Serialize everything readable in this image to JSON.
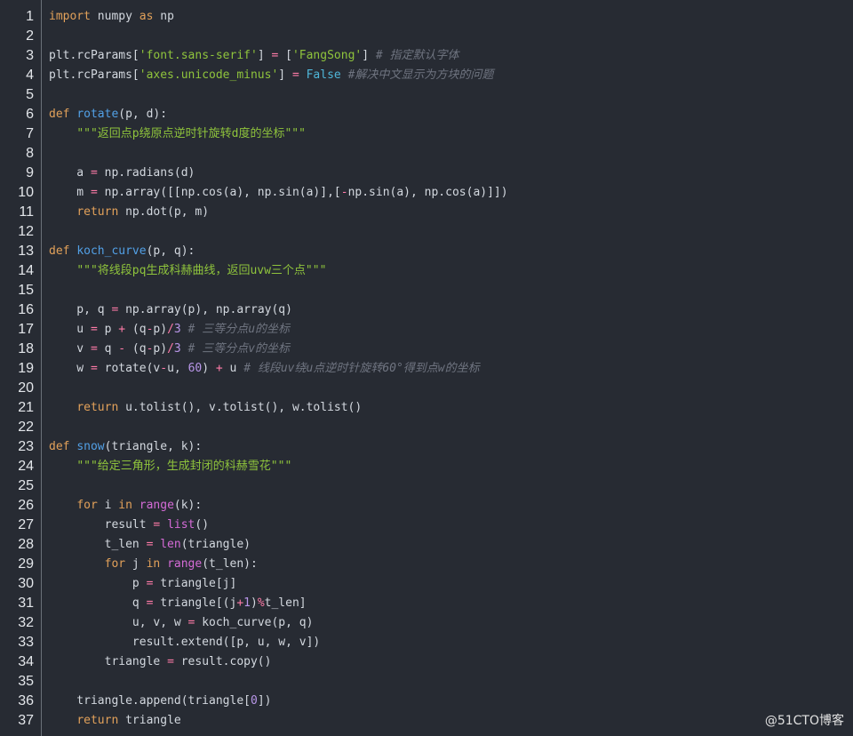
{
  "theme": {
    "background": "#272b33",
    "text": "#d3d8df",
    "keyword": "#e2a15a",
    "function": "#52a0e6",
    "string": "#8fc43c",
    "number": "#b896e8",
    "operator": "#ff7ba8",
    "constant": "#4fb6d8",
    "builtin": "#d46bd6",
    "comment": "#6f7480"
  },
  "watermark": "@51CTO博客",
  "lines": [
    {
      "n": "1",
      "tokens": [
        {
          "t": "import",
          "c": "kw"
        },
        {
          "t": " numpy ",
          "c": ""
        },
        {
          "t": "as",
          "c": "kw"
        },
        {
          "t": " np",
          "c": ""
        }
      ]
    },
    {
      "n": "2",
      "tokens": []
    },
    {
      "n": "3",
      "tokens": [
        {
          "t": "plt.rcParams[",
          "c": ""
        },
        {
          "t": "'font.sans-serif'",
          "c": "str"
        },
        {
          "t": "] ",
          "c": ""
        },
        {
          "t": "=",
          "c": "op"
        },
        {
          "t": " [",
          "c": ""
        },
        {
          "t": "'FangSong'",
          "c": "str"
        },
        {
          "t": "] ",
          "c": ""
        },
        {
          "t": "# 指定默认字体",
          "c": "cm"
        }
      ]
    },
    {
      "n": "4",
      "tokens": [
        {
          "t": "plt.rcParams[",
          "c": ""
        },
        {
          "t": "'axes.unicode_minus'",
          "c": "str"
        },
        {
          "t": "] ",
          "c": ""
        },
        {
          "t": "=",
          "c": "op"
        },
        {
          "t": " ",
          "c": ""
        },
        {
          "t": "False",
          "c": "const"
        },
        {
          "t": " #解决中文显示为方块的问题",
          "c": "cm"
        }
      ]
    },
    {
      "n": "5",
      "tokens": []
    },
    {
      "n": "6",
      "tokens": [
        {
          "t": "def",
          "c": "kw"
        },
        {
          "t": " ",
          "c": ""
        },
        {
          "t": "rotate",
          "c": "fn"
        },
        {
          "t": "(p, d):",
          "c": ""
        }
      ]
    },
    {
      "n": "7",
      "tokens": [
        {
          "t": "    ",
          "c": ""
        },
        {
          "t": "\"\"\"返回点p绕原点逆时针旋转d度的坐标\"\"\"",
          "c": "doc"
        }
      ]
    },
    {
      "n": "8",
      "tokens": []
    },
    {
      "n": "9",
      "tokens": [
        {
          "t": "    a ",
          "c": ""
        },
        {
          "t": "=",
          "c": "op"
        },
        {
          "t": " np.radians(d)",
          "c": ""
        }
      ]
    },
    {
      "n": "10",
      "tokens": [
        {
          "t": "    m ",
          "c": ""
        },
        {
          "t": "=",
          "c": "op"
        },
        {
          "t": " np.array([[np.cos(a), np.sin(a)],[",
          "c": ""
        },
        {
          "t": "-",
          "c": "op"
        },
        {
          "t": "np.sin(a), np.cos(a)]])",
          "c": ""
        }
      ]
    },
    {
      "n": "11",
      "tokens": [
        {
          "t": "    ",
          "c": ""
        },
        {
          "t": "return",
          "c": "kw"
        },
        {
          "t": " np.dot(p, m)",
          "c": ""
        }
      ]
    },
    {
      "n": "12",
      "tokens": []
    },
    {
      "n": "13",
      "tokens": [
        {
          "t": "def",
          "c": "kw"
        },
        {
          "t": " ",
          "c": ""
        },
        {
          "t": "koch_curve",
          "c": "fn"
        },
        {
          "t": "(p, q):",
          "c": ""
        }
      ]
    },
    {
      "n": "14",
      "tokens": [
        {
          "t": "    ",
          "c": ""
        },
        {
          "t": "\"\"\"将线段pq生成科赫曲线，返回uvw三个点\"\"\"",
          "c": "doc"
        }
      ]
    },
    {
      "n": "15",
      "tokens": []
    },
    {
      "n": "16",
      "tokens": [
        {
          "t": "    p, q ",
          "c": ""
        },
        {
          "t": "=",
          "c": "op"
        },
        {
          "t": " np.array(p), np.array(q)",
          "c": ""
        }
      ]
    },
    {
      "n": "17",
      "tokens": [
        {
          "t": "    u ",
          "c": ""
        },
        {
          "t": "=",
          "c": "op"
        },
        {
          "t": " p ",
          "c": ""
        },
        {
          "t": "+",
          "c": "op"
        },
        {
          "t": " (q",
          "c": ""
        },
        {
          "t": "-",
          "c": "op"
        },
        {
          "t": "p)",
          "c": ""
        },
        {
          "t": "/",
          "c": "op"
        },
        {
          "t": "3",
          "c": "num"
        },
        {
          "t": " # 三等分点u的坐标",
          "c": "cm"
        }
      ]
    },
    {
      "n": "18",
      "tokens": [
        {
          "t": "    v ",
          "c": ""
        },
        {
          "t": "=",
          "c": "op"
        },
        {
          "t": " q ",
          "c": ""
        },
        {
          "t": "-",
          "c": "op"
        },
        {
          "t": " (q",
          "c": ""
        },
        {
          "t": "-",
          "c": "op"
        },
        {
          "t": "p)",
          "c": ""
        },
        {
          "t": "/",
          "c": "op"
        },
        {
          "t": "3",
          "c": "num"
        },
        {
          "t": " # 三等分点v的坐标",
          "c": "cm"
        }
      ]
    },
    {
      "n": "19",
      "tokens": [
        {
          "t": "    w ",
          "c": ""
        },
        {
          "t": "=",
          "c": "op"
        },
        {
          "t": " rotate(v",
          "c": ""
        },
        {
          "t": "-",
          "c": "op"
        },
        {
          "t": "u, ",
          "c": ""
        },
        {
          "t": "60",
          "c": "num"
        },
        {
          "t": ") ",
          "c": ""
        },
        {
          "t": "+",
          "c": "op"
        },
        {
          "t": " u ",
          "c": ""
        },
        {
          "t": "# 线段uv绕u点逆时针旋转60°得到点w的坐标",
          "c": "cm"
        }
      ]
    },
    {
      "n": "20",
      "tokens": []
    },
    {
      "n": "21",
      "tokens": [
        {
          "t": "    ",
          "c": ""
        },
        {
          "t": "return",
          "c": "kw"
        },
        {
          "t": " u.tolist(), v.tolist(), w.tolist()",
          "c": ""
        }
      ]
    },
    {
      "n": "22",
      "tokens": []
    },
    {
      "n": "23",
      "tokens": [
        {
          "t": "def",
          "c": "kw"
        },
        {
          "t": " ",
          "c": ""
        },
        {
          "t": "snow",
          "c": "fn"
        },
        {
          "t": "(triangle, k):",
          "c": ""
        }
      ]
    },
    {
      "n": "24",
      "tokens": [
        {
          "t": "    ",
          "c": ""
        },
        {
          "t": "\"\"\"给定三角形，生成封闭的科赫雪花\"\"\"",
          "c": "doc"
        }
      ]
    },
    {
      "n": "25",
      "tokens": []
    },
    {
      "n": "26",
      "tokens": [
        {
          "t": "    ",
          "c": ""
        },
        {
          "t": "for",
          "c": "kw"
        },
        {
          "t": " i ",
          "c": ""
        },
        {
          "t": "in",
          "c": "kw"
        },
        {
          "t": " ",
          "c": ""
        },
        {
          "t": "range",
          "c": "bi"
        },
        {
          "t": "(k):",
          "c": ""
        }
      ]
    },
    {
      "n": "27",
      "tokens": [
        {
          "t": "        result ",
          "c": ""
        },
        {
          "t": "=",
          "c": "op"
        },
        {
          "t": " ",
          "c": ""
        },
        {
          "t": "list",
          "c": "bi"
        },
        {
          "t": "()",
          "c": ""
        }
      ]
    },
    {
      "n": "28",
      "tokens": [
        {
          "t": "        t_len ",
          "c": ""
        },
        {
          "t": "=",
          "c": "op"
        },
        {
          "t": " ",
          "c": ""
        },
        {
          "t": "len",
          "c": "bi"
        },
        {
          "t": "(triangle)",
          "c": ""
        }
      ]
    },
    {
      "n": "29",
      "tokens": [
        {
          "t": "        ",
          "c": ""
        },
        {
          "t": "for",
          "c": "kw"
        },
        {
          "t": " j ",
          "c": ""
        },
        {
          "t": "in",
          "c": "kw"
        },
        {
          "t": " ",
          "c": ""
        },
        {
          "t": "range",
          "c": "bi"
        },
        {
          "t": "(t_len):",
          "c": ""
        }
      ]
    },
    {
      "n": "30",
      "tokens": [
        {
          "t": "            p ",
          "c": ""
        },
        {
          "t": "=",
          "c": "op"
        },
        {
          "t": " triangle[j]",
          "c": ""
        }
      ]
    },
    {
      "n": "31",
      "tokens": [
        {
          "t": "            q ",
          "c": ""
        },
        {
          "t": "=",
          "c": "op"
        },
        {
          "t": " triangle[(j",
          "c": ""
        },
        {
          "t": "+",
          "c": "op"
        },
        {
          "t": "1",
          "c": "num"
        },
        {
          "t": ")",
          "c": ""
        },
        {
          "t": "%",
          "c": "op"
        },
        {
          "t": "t_len]",
          "c": ""
        }
      ]
    },
    {
      "n": "32",
      "tokens": [
        {
          "t": "            u, v, w ",
          "c": ""
        },
        {
          "t": "=",
          "c": "op"
        },
        {
          "t": " koch_curve(p, q)",
          "c": ""
        }
      ]
    },
    {
      "n": "33",
      "tokens": [
        {
          "t": "            result.extend([p, u, w, v])",
          "c": ""
        }
      ]
    },
    {
      "n": "34",
      "tokens": [
        {
          "t": "        triangle ",
          "c": ""
        },
        {
          "t": "=",
          "c": "op"
        },
        {
          "t": " result.copy()",
          "c": ""
        }
      ]
    },
    {
      "n": "35",
      "tokens": []
    },
    {
      "n": "36",
      "tokens": [
        {
          "t": "    triangle.append(triangle[",
          "c": ""
        },
        {
          "t": "0",
          "c": "num"
        },
        {
          "t": "])",
          "c": ""
        }
      ]
    },
    {
      "n": "37",
      "tokens": [
        {
          "t": "    ",
          "c": ""
        },
        {
          "t": "return",
          "c": "kw"
        },
        {
          "t": " triangle",
          "c": ""
        }
      ]
    }
  ]
}
